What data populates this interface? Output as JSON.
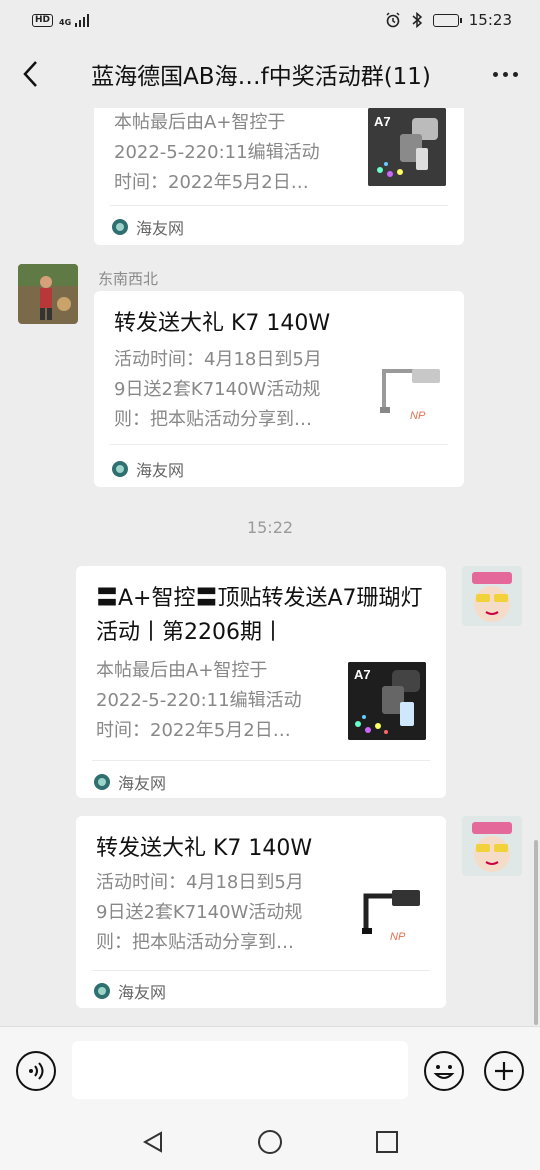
{
  "status_bar": {
    "hd": "HD",
    "network": "4G",
    "time": "15:23"
  },
  "header": {
    "title": "蓝海德国AB海…f中奖活动群(11)",
    "back_icon": "chevron-left-icon",
    "more_icon": "more-dots-icon"
  },
  "messages": [
    {
      "side": "left",
      "partial": true,
      "desc": [
        "本帖最后由A+智控于",
        "2022-5-220:11编辑活动",
        "时间：2022年5月2日…"
      ],
      "thumb_label": "A7",
      "source": "海友网"
    },
    {
      "side": "left",
      "sender": "东南西北",
      "title": "转发送大礼 K7 140W",
      "desc": [
        "活动时间：4月18日到5月",
        "9日送2套K7140W活动规",
        "则：把本贴活动分享到…"
      ],
      "source": "海友网"
    },
    {
      "type": "timestamp",
      "text": "15:22"
    },
    {
      "side": "right",
      "title": "〓A+智控〓顶贴转发送A7珊瑚灯活动丨第2206期丨",
      "desc": [
        "本帖最后由A+智控于",
        "2022-5-220:11编辑活动",
        "时间：2022年5月2日…"
      ],
      "thumb_label": "A7",
      "source": "海友网"
    },
    {
      "side": "right",
      "title": "转发送大礼 K7 140W",
      "desc": [
        "活动时间：4月18日到5月",
        "9日送2套K7140W活动规",
        "则：把本贴活动分享到…"
      ],
      "source": "海友网"
    }
  ],
  "input_bar": {
    "placeholder": "",
    "voice_icon": "voice-icon",
    "emoji_icon": "emoji-icon",
    "plus_icon": "plus-icon"
  },
  "nav_bar": {
    "icons": [
      "nav-back-icon",
      "nav-home-icon",
      "nav-recents-icon"
    ]
  }
}
